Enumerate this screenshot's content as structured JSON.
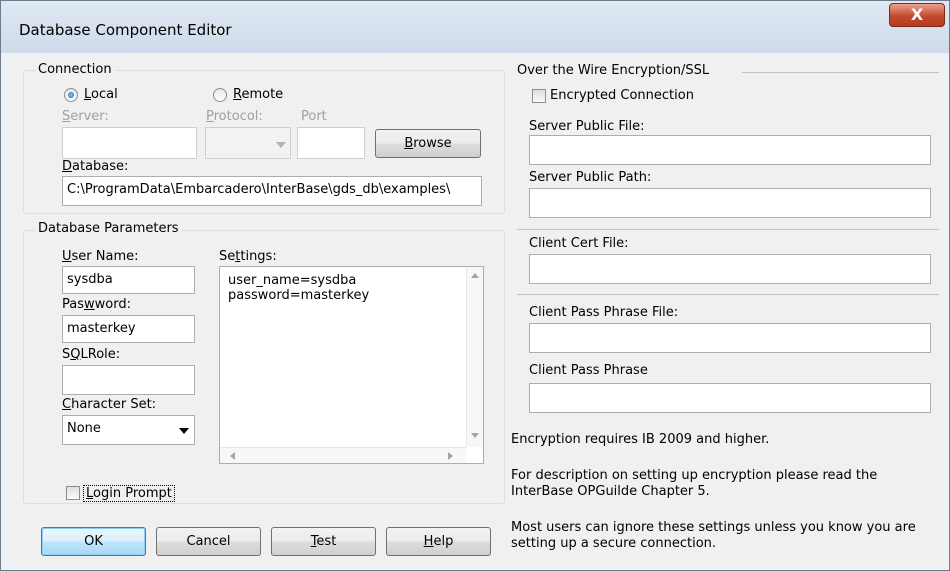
{
  "window": {
    "title": "Database Component Editor",
    "close_glyph": "X"
  },
  "connection": {
    "group_title": "Connection",
    "local_label": "Local",
    "remote_label": "Remote",
    "server_label": "Server:",
    "protocol_label": "Protocol:",
    "port_label": "Port",
    "server_value": "",
    "port_value": "",
    "browse_label": "Browse",
    "database_label": "Database:",
    "database_value": "C:\\ProgramData\\Embarcadero\\InterBase\\gds_db\\examples\\"
  },
  "params": {
    "group_title": "Database Parameters",
    "user_name_label": "User Name:",
    "user_name_value": "sysdba",
    "password_label": "Password:",
    "password_value": "masterkey",
    "sqlrole_label": "SQLRole:",
    "sqlrole_value": "",
    "charset_label": "Character Set:",
    "charset_value": "None",
    "settings_label": "Settings:",
    "settings_line1": "user_name=sysdba",
    "settings_line2": "password=masterkey",
    "login_prompt_label": "Login Prompt"
  },
  "ssl": {
    "group_title": "Over the Wire Encryption/SSL",
    "encrypted_label": "Encrypted Connection",
    "server_public_file_label": "Server Public File:",
    "server_public_path_label": "Server Public Path:",
    "client_cert_file_label": "Client Cert File:",
    "client_pass_phrase_file_label": "Client Pass Phrase File:",
    "client_pass_phrase_label": "Client Pass Phrase",
    "note1": "Encryption requires IB 2009 and higher.",
    "note2_line1": "For description on setting up encryption please read the",
    "note2_line2": "InterBase OPGuilde Chapter 5.",
    "note3_line1": "Most users can ignore these settings unless you know you are",
    "note3_line2": "setting up a secure connection."
  },
  "buttons": {
    "ok": "OK",
    "cancel": "Cancel",
    "test": "Test",
    "help": "Help"
  }
}
